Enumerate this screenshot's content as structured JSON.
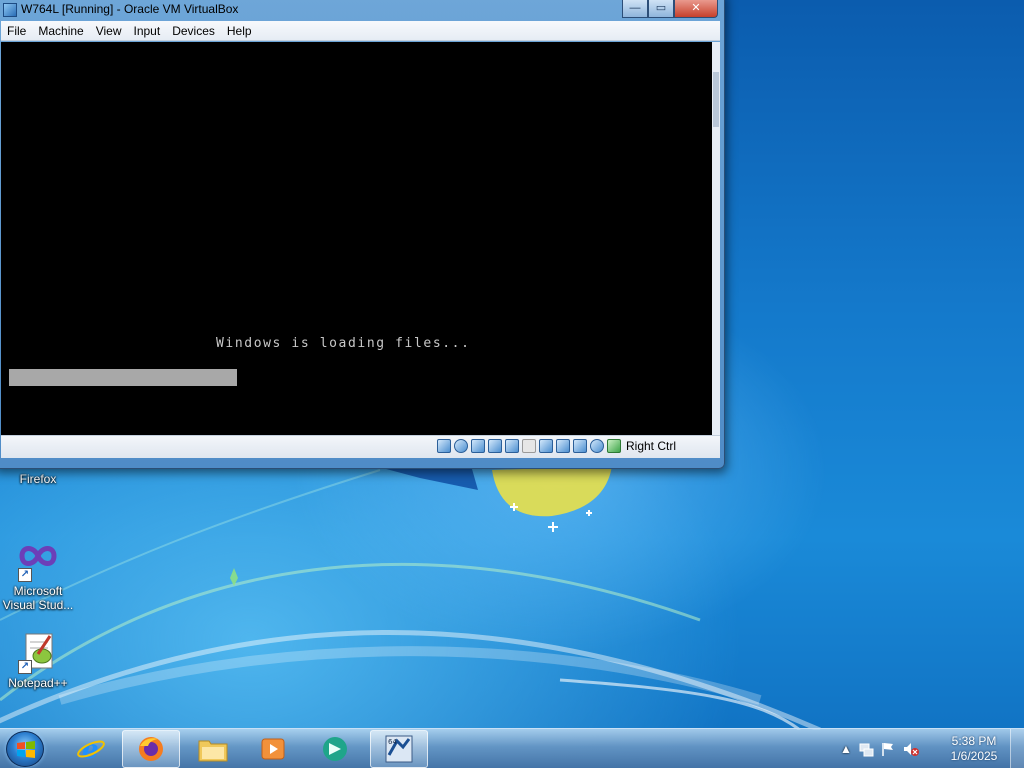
{
  "vbox_window": {
    "title": "W764L [Running] - Oracle VM VirtualBox",
    "menu": [
      "File",
      "Machine",
      "View",
      "Input",
      "Devices",
      "Help"
    ],
    "window_buttons": [
      "minimize",
      "maximize",
      "close"
    ],
    "guest_screen": {
      "message": "Windows is loading files...",
      "progress_fraction": 0.33,
      "background": "#000000",
      "text_color": "#c8c8c8",
      "bar_color": "#a8a8a8"
    },
    "status_icons": [
      "hard-disk-icon",
      "optical-drive-icon",
      "audio-icon",
      "network-icon",
      "usb-icon",
      "shared-folders-icon",
      "display-icon",
      "video-capture-icon",
      "virtualization-icon",
      "mouse-integration-icon",
      "cpu-icon"
    ],
    "host_key": "Right Ctrl"
  },
  "desktop_icons": [
    {
      "label": "Firefox",
      "icon": "firefox-icon"
    },
    {
      "label": "Microsoft Visual Stud...",
      "icon": "visual-studio-icon"
    },
    {
      "label": "Notepad++",
      "icon": "notepadpp-icon"
    }
  ],
  "taskbar": {
    "start": "start-orb",
    "pinned": [
      "internet-explorer-icon",
      "firefox-icon",
      "file-explorer-icon",
      "media-player-icon",
      "app-icon",
      "virtualbox-icon"
    ],
    "active": [
      "firefox-icon",
      "virtualbox-icon"
    ],
    "tray_icons": [
      "show-hidden-icons",
      "network-icon",
      "action-center-flag-icon",
      "volume-muted-icon"
    ],
    "clock_time": "5:38 PM",
    "clock_date": "1/6/2025"
  },
  "colors": {
    "desktop_blue": "#1479cb",
    "titlebar": "#6ea6d8",
    "menubar": "#eef2f8"
  }
}
